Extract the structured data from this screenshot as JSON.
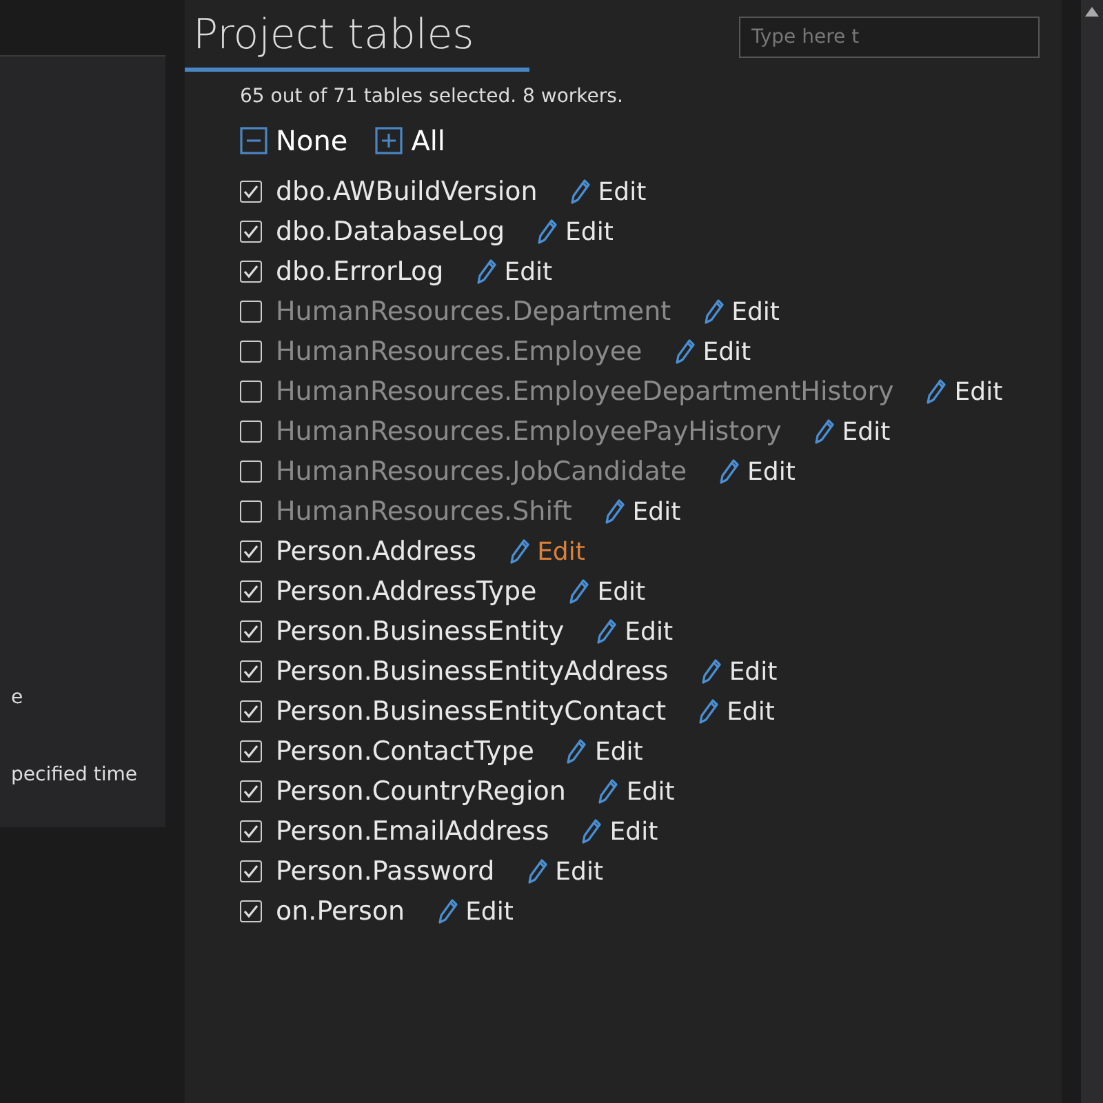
{
  "side_panel": {
    "texts": [
      "e",
      "pecified time"
    ]
  },
  "title": "Project tables",
  "search": {
    "placeholder": "Type here t"
  },
  "summary": "65 out of 71 tables selected. 8 workers.",
  "bulk_actions": [
    {
      "kind": "none",
      "label": "None"
    },
    {
      "kind": "all",
      "label": "All"
    }
  ],
  "tables": [
    {
      "name": "dbo.AWBuildVersion",
      "checked": true,
      "edit": "Edit",
      "hovered": false
    },
    {
      "name": "dbo.DatabaseLog",
      "checked": true,
      "edit": "Edit",
      "hovered": false
    },
    {
      "name": "dbo.ErrorLog",
      "checked": true,
      "edit": "Edit",
      "hovered": false
    },
    {
      "name": "HumanResources.Department",
      "checked": false,
      "edit": "Edit",
      "hovered": false
    },
    {
      "name": "HumanResources.Employee",
      "checked": false,
      "edit": "Edit",
      "hovered": false
    },
    {
      "name": "HumanResources.EmployeeDepartmentHistory",
      "checked": false,
      "edit": "Edit",
      "hovered": false
    },
    {
      "name": "HumanResources.EmployeePayHistory",
      "checked": false,
      "edit": "Edit",
      "hovered": false
    },
    {
      "name": "HumanResources.JobCandidate",
      "checked": false,
      "edit": "Edit",
      "hovered": false
    },
    {
      "name": "HumanResources.Shift",
      "checked": false,
      "edit": "Edit",
      "hovered": false
    },
    {
      "name": "Person.Address",
      "checked": true,
      "edit": "Edit",
      "hovered": true
    },
    {
      "name": "Person.AddressType",
      "checked": true,
      "edit": "Edit",
      "hovered": false
    },
    {
      "name": "Person.BusinessEntity",
      "checked": true,
      "edit": "Edit",
      "hovered": false
    },
    {
      "name": "Person.BusinessEntityAddress",
      "checked": true,
      "edit": "Edit",
      "hovered": false
    },
    {
      "name": "Person.BusinessEntityContact",
      "checked": true,
      "edit": "Edit",
      "hovered": false
    },
    {
      "name": "Person.ContactType",
      "checked": true,
      "edit": "Edit",
      "hovered": false
    },
    {
      "name": "Person.CountryRegion",
      "checked": true,
      "edit": "Edit",
      "hovered": false
    },
    {
      "name": "Person.EmailAddress",
      "checked": true,
      "edit": "Edit",
      "hovered": false
    },
    {
      "name": "Person.Password",
      "checked": true,
      "edit": "Edit",
      "hovered": false
    },
    {
      "name": "on.Person",
      "checked": true,
      "edit": "Edit",
      "hovered": false
    }
  ]
}
